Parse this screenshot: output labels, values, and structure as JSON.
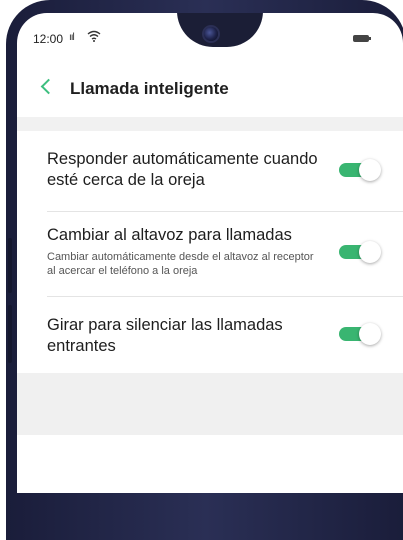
{
  "status_bar": {
    "time": "12:00",
    "signal_text": "ııl"
  },
  "header": {
    "title": "Llamada inteligente"
  },
  "settings": [
    {
      "title": "Responder automáticamente cuando esté cerca de la oreja",
      "subtitle": "",
      "enabled": true
    },
    {
      "title": "Cambiar al altavoz para llamadas",
      "subtitle": "Cambiar automáticamente desde el altavoz al receptor al acercar el teléfono a la oreja",
      "enabled": true
    },
    {
      "title": "Girar para silenciar las llamadas entrantes",
      "subtitle": "",
      "enabled": true
    }
  ],
  "colors": {
    "accent": "#39b571",
    "phone_frame": "#1f2340"
  },
  "icons": {
    "back": "chevron-left-icon",
    "wifi": "wifi-icon",
    "battery": "battery-icon",
    "signal": "signal-icon"
  }
}
